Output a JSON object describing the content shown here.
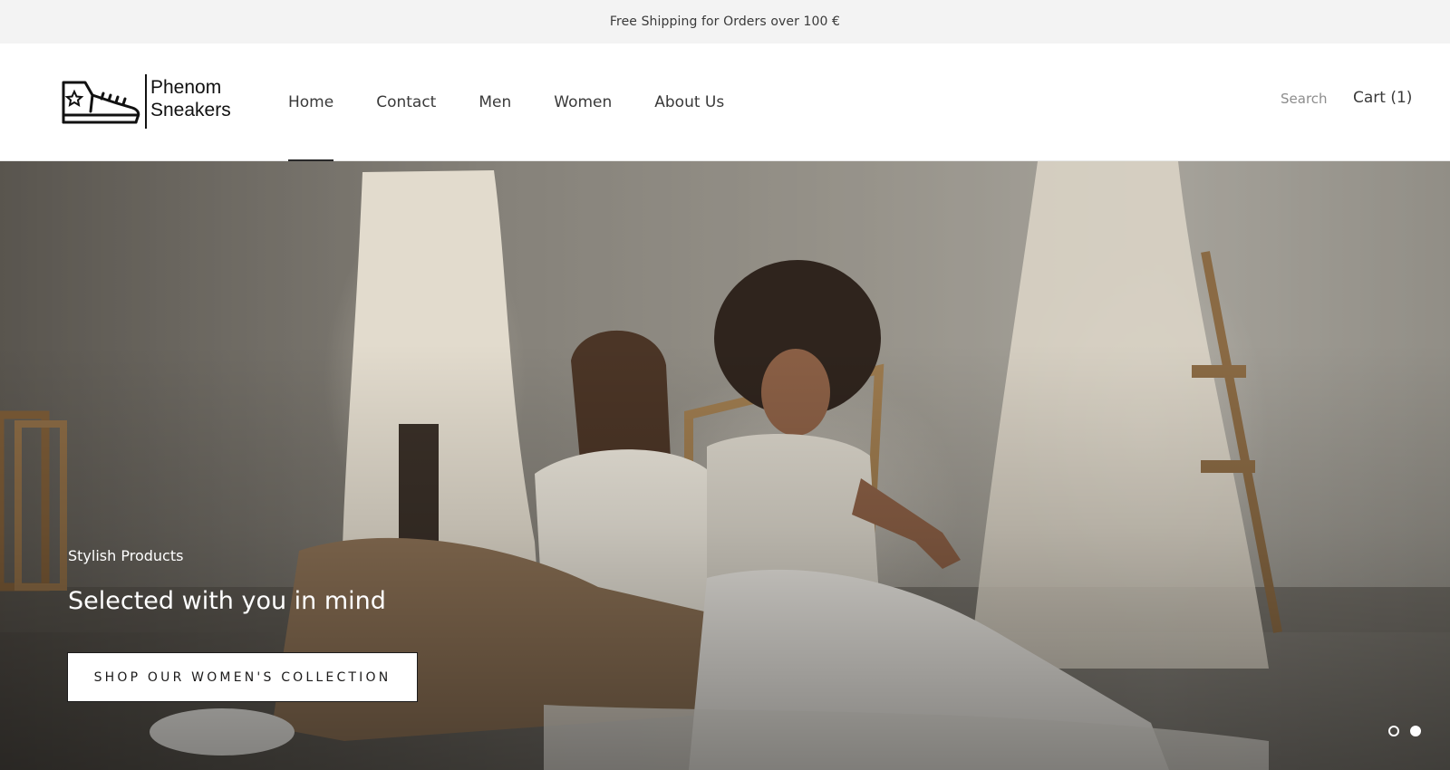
{
  "announcement": {
    "text": "Free Shipping for Orders over 100 €"
  },
  "brand": {
    "name_line1": "Phenom",
    "name_line2": "Sneakers",
    "logo_icon": "sneaker-icon"
  },
  "nav": {
    "items": [
      {
        "label": "Home",
        "active": true
      },
      {
        "label": "Contact",
        "active": false
      },
      {
        "label": "Men",
        "active": false
      },
      {
        "label": "Women",
        "active": false
      },
      {
        "label": "About Us",
        "active": false
      }
    ]
  },
  "header_actions": {
    "search_label": "Search",
    "cart_label": "Cart (1)"
  },
  "hero": {
    "subheading": "Stylish Products",
    "heading": "Selected with you in mind",
    "button_label": "SHOP OUR WOMEN'S COLLECTION",
    "slides_total": 2,
    "active_slide": 2
  },
  "colors": {
    "text": "#1c1b1b",
    "announcement_bg": "#f3f3f3",
    "accent": "#ffffff"
  }
}
